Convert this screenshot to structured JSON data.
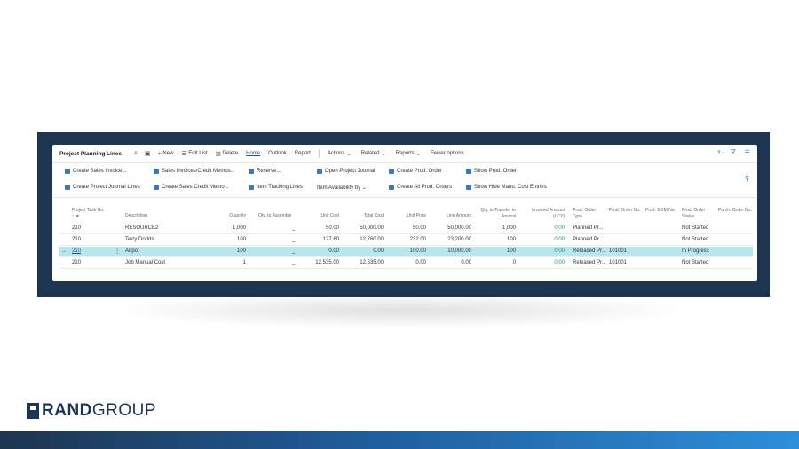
{
  "page": {
    "title": "Project Planning Lines"
  },
  "toolbar": {
    "items": [
      "New",
      "Edit List",
      "Delete",
      "Home",
      "Outlook",
      "Report",
      "Actions",
      "Related",
      "Reports",
      "Fewer options"
    ]
  },
  "actions": {
    "row1": [
      "Create Sales Invoice...",
      "Sales Invoices/Credit Memos...",
      "Reserve...",
      "Open Project Journal",
      "Create Prod. Order",
      "Show Prod. Order"
    ],
    "row2": [
      "Create Project Journal Lines",
      "Create Sales Credit Memo...",
      "Item Tracking Lines",
      "Item Availability by",
      "Create All Prod. Orders",
      "Show Hide Manu. Cost Entries"
    ]
  },
  "columns": [
    "Project Task No. ↑",
    "Description",
    "Quantity",
    "Qty. to Assemble",
    "Unit Cost",
    "Total Cost",
    "Unit Price",
    "Line Amount",
    "Qty. to Transfer to Journal",
    "Invoiced Amount (LCY)",
    "Prod. Order Type",
    "Prod. Order No.",
    "Prod. BOM No.",
    "Prod. Order Status",
    "Purch. Order No."
  ],
  "rows": [
    {
      "task": "210",
      "description": "RESOURCE2",
      "quantity": "1,000",
      "qty_assemble": "_",
      "unit_cost": "50.00",
      "total_cost": "50,000.00",
      "unit_price": "50.00",
      "line_amount": "50,000.00",
      "qty_transfer": "1,000",
      "invoiced": "0.00",
      "order_type": "Planned Pr...",
      "order_no": "",
      "status": "Not Started"
    },
    {
      "task": "210",
      "description": "Terry Dodds",
      "quantity": "100",
      "qty_assemble": "_",
      "unit_cost": "127.60",
      "total_cost": "12,760.00",
      "unit_price": "232.00",
      "line_amount": "23,200.00",
      "qty_transfer": "100",
      "invoiced": "0.00",
      "order_type": "Planned Pr...",
      "order_no": "",
      "status": "Not Started"
    },
    {
      "task": "210",
      "description": "Airpot",
      "quantity": "100",
      "qty_assemble": "_",
      "unit_cost": "0.00",
      "total_cost": "0.00",
      "unit_price": "100.00",
      "line_amount": "10,000.00",
      "qty_transfer": "100",
      "invoiced": "0.00",
      "order_type": "Released Pr...",
      "order_no": "101001",
      "status": "In Progress"
    },
    {
      "task": "210",
      "description": "Job Manual Cost",
      "quantity": "1",
      "qty_assemble": "_",
      "unit_cost": "12,535.00",
      "total_cost": "12,535.00",
      "unit_price": "0.00",
      "line_amount": "0.00",
      "qty_transfer": "0",
      "invoiced": "0.00",
      "order_type": "Released Pr...",
      "order_no": "101001",
      "status": "Not Started"
    }
  ],
  "branding": {
    "part1": "RAND",
    "part2": "GROUP"
  }
}
